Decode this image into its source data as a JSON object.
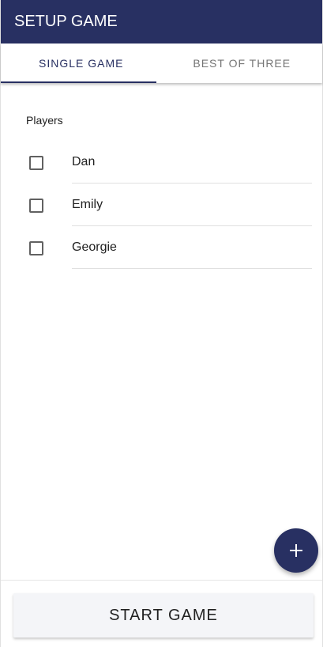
{
  "app_bar": {
    "title": "SETUP GAME",
    "color": "#283062"
  },
  "tabs": [
    {
      "label": "SINGLE GAME",
      "active": true
    },
    {
      "label": "BEST OF THREE",
      "active": false
    }
  ],
  "players_section": {
    "label": "Players",
    "players": [
      {
        "name": "Dan",
        "checked": false
      },
      {
        "name": "Emily",
        "checked": false
      },
      {
        "name": "Georgie",
        "checked": false
      }
    ]
  },
  "fab": {
    "icon": "plus-icon"
  },
  "start_button": {
    "label": "START GAME"
  }
}
